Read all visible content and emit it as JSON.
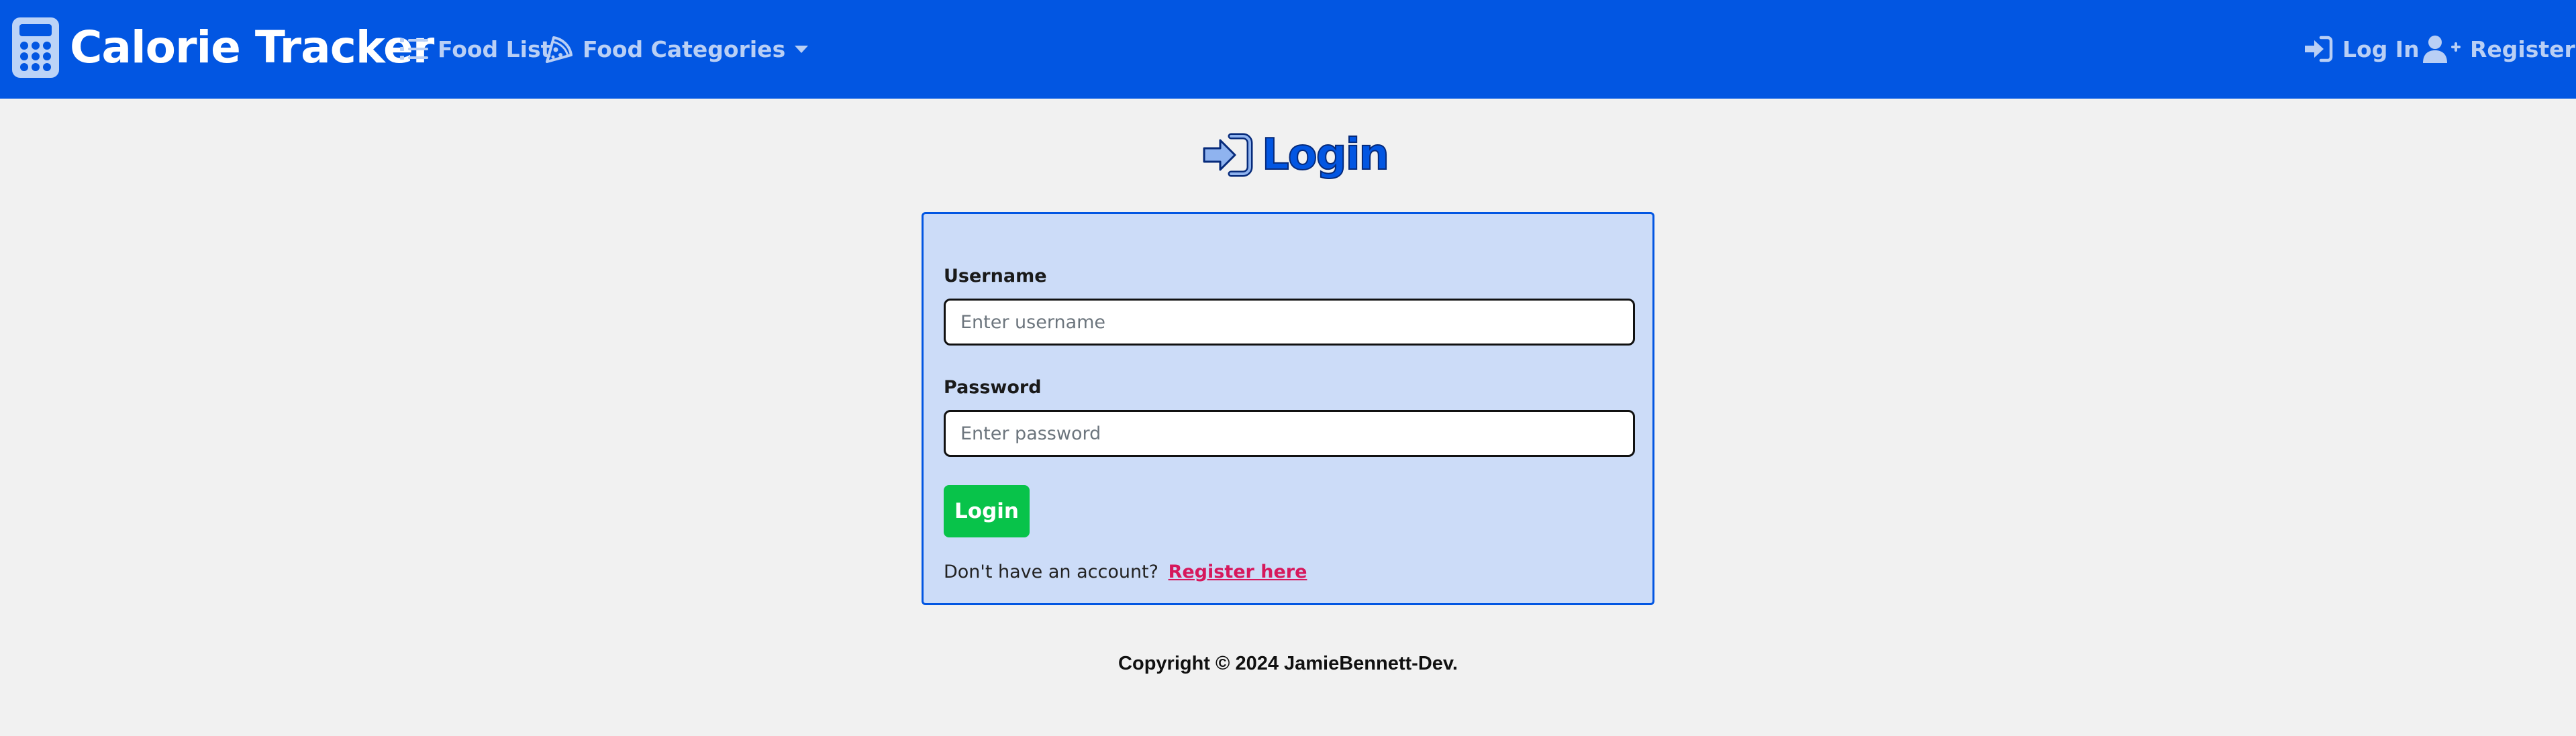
{
  "app": {
    "brand": "Calorie Tracker",
    "brand_icon": "calculator-icon"
  },
  "nav": {
    "food_list": {
      "label": "Food List",
      "icon": "list-icon"
    },
    "food_categories": {
      "label": "Food Categories",
      "icon": "pizza-slice-icon",
      "dropdown": true
    },
    "login": {
      "label": "Log In",
      "icon": "sign-in-icon"
    },
    "register": {
      "label": "Register",
      "icon": "user-plus-icon"
    }
  },
  "page": {
    "title": "Login",
    "title_icon": "sign-in-icon"
  },
  "form": {
    "username_label": "Username",
    "username_placeholder": "Enter username",
    "username_value": "",
    "password_label": "Password",
    "password_placeholder": "Enter password",
    "password_value": "",
    "submit_label": "Login",
    "register_prompt": "Don't have an account?",
    "register_link": "Register here"
  },
  "footer": {
    "text": "Copyright © 2024 JamieBennett-Dev."
  },
  "colors": {
    "navbar": "#0256e2",
    "nav_link": "#b9cff5",
    "page_bg": "#f1f1f1",
    "card_bg": "#ccdcf8",
    "card_border": "#0256e2",
    "submit_button": "#08c34a",
    "register_link": "#d6185c"
  }
}
